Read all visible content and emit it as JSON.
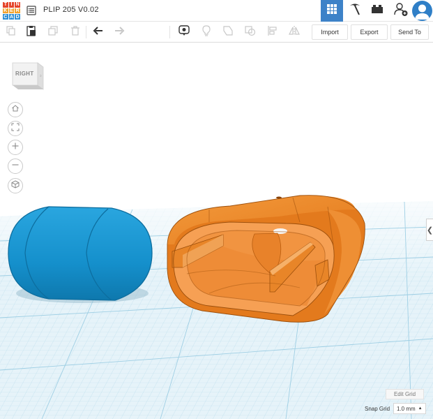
{
  "app": {
    "logo_letters": [
      "T",
      "I",
      "N",
      "K",
      "E",
      "R",
      "C",
      "A",
      "D"
    ],
    "logo_colors": [
      "#e5452b",
      "#e5452b",
      "#e5452b",
      "#f3a22c",
      "#f3a22c",
      "#f3a22c",
      "#2f8fd6",
      "#2f8fd6",
      "#2f8fd6"
    ],
    "design_title": "PLIP 205 V0.02"
  },
  "topbar": {
    "views": [
      {
        "name": "3d-design-view",
        "icon": "grid-icon",
        "active": true
      },
      {
        "name": "codeblocks-view",
        "icon": "pickaxe-icon",
        "active": false
      },
      {
        "name": "bricks-view",
        "icon": "brick-icon",
        "active": false
      }
    ],
    "invite_icon": "add-user-icon",
    "avatar_icon": "user-avatar-icon",
    "accent_color": "#3d82c8"
  },
  "toolbar": {
    "tools": [
      {
        "name": "copy-button",
        "icon": "copy-icon"
      },
      {
        "name": "paste-button",
        "icon": "paste-icon"
      },
      {
        "name": "duplicate-button",
        "icon": "duplicate-icon"
      },
      {
        "name": "delete-button",
        "icon": "trash-icon"
      },
      {
        "name": "undo-button",
        "icon": "undo-icon"
      },
      {
        "name": "redo-button",
        "icon": "redo-icon"
      },
      {
        "name": "notes-button",
        "icon": "speech-bubble-icon"
      },
      {
        "name": "light-button",
        "icon": "lightbulb-icon"
      },
      {
        "name": "group-button",
        "icon": "shape-group-icon"
      },
      {
        "name": "ungroup-button",
        "icon": "shape-ungroup-icon"
      },
      {
        "name": "align-button",
        "icon": "align-icon"
      },
      {
        "name": "mirror-button",
        "icon": "mirror-icon"
      }
    ],
    "import_label": "Import",
    "export_label": "Export",
    "send_to_label": "Send To"
  },
  "viewcube": {
    "face_label": "RIGHT"
  },
  "nav_controls": [
    {
      "name": "home-view-button",
      "icon": "home-icon"
    },
    {
      "name": "fit-view-button",
      "icon": "fit-all-icon"
    },
    {
      "name": "zoom-in-button",
      "icon": "plus-icon"
    },
    {
      "name": "zoom-out-button",
      "icon": "minus-icon"
    },
    {
      "name": "perspective-button",
      "icon": "cube-icon"
    }
  ],
  "scene": {
    "shapes": [
      {
        "name": "blue-capsule-shape",
        "color": "#1a96d3"
      },
      {
        "name": "orange-shell-shape",
        "color": "#ef8a2a"
      }
    ],
    "grid_color": "#b6d9ea"
  },
  "grid": {
    "edit_grid_label": "Edit Grid",
    "snap_grid_label": "Snap Grid",
    "snap_value": "1.0 mm"
  },
  "panel_toggle_glyph": "❮"
}
